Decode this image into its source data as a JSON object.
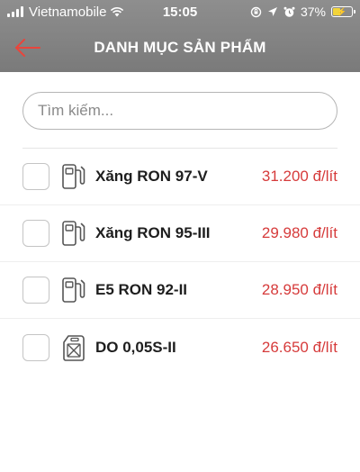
{
  "status_bar": {
    "carrier": "Vietnamobile",
    "time": "15:05",
    "battery": "37%"
  },
  "header": {
    "title": "DANH MỤC SẢN PHẨM",
    "back_icon": "back-arrow-icon",
    "accent_color": "#e8453c"
  },
  "search": {
    "placeholder": "Tìm kiếm...",
    "value": ""
  },
  "products": [
    {
      "name": "Xăng RON 97-V",
      "price": "31.200 đ/lít",
      "icon": "fuel-pump-icon",
      "checked": false
    },
    {
      "name": "Xăng RON 95-III",
      "price": "29.980 đ/lít",
      "icon": "fuel-pump-icon",
      "checked": false
    },
    {
      "name": "E5 RON 92-II",
      "price": "28.950 đ/lít",
      "icon": "fuel-pump-icon",
      "checked": false
    },
    {
      "name": "DO 0,05S-II",
      "price": "26.650 đ/lít",
      "icon": "jerry-can-icon",
      "checked": false
    }
  ],
  "colors": {
    "price": "#d63b3b",
    "header_bg": "#868686"
  }
}
